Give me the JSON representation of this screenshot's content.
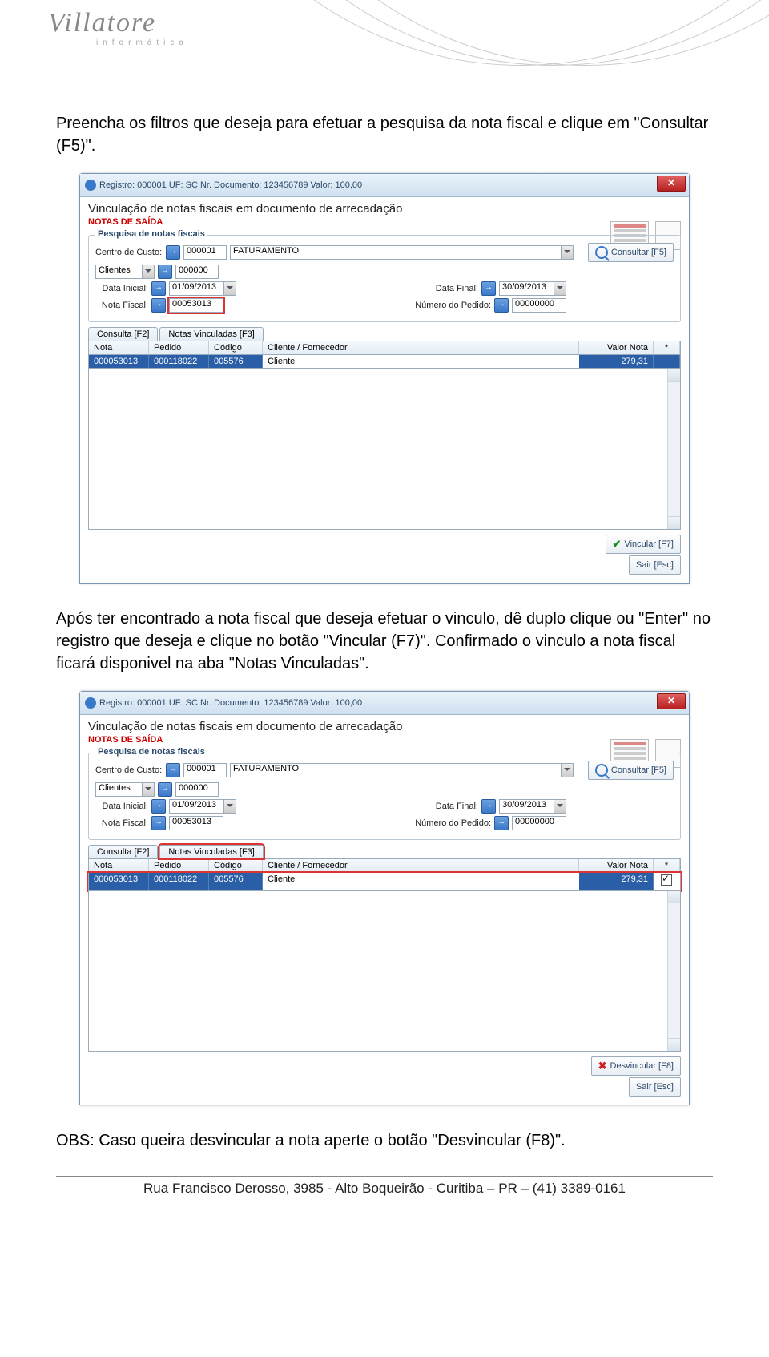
{
  "logo": {
    "brand": "Villatore",
    "sub": "informática"
  },
  "para1": "Preencha os filtros que deseja para efetuar a pesquisa da nota fiscal e clique em \"Consultar (F5)\".",
  "para2": "Após ter encontrado a nota fiscal que deseja efetuar o vinculo, dê duplo clique ou \"Enter\" no registro que deseja e clique no botão \"Vincular (F7)\". Confirmado o vinculo a nota fiscal ficará disponivel na aba \"Notas Vinculadas\".",
  "para3": "OBS: Caso queira desvincular a nota aperte o botão \"Desvincular (F8)\".",
  "footer": "Rua Francisco Derosso, 3985  - Alto Boqueirão - Curitiba – PR  – (41) 3389-0161",
  "win": {
    "title": "Registro: 000001 UF: SC Nr. Documento: 123456789 Valor: 100,00",
    "heading": "Vinculação de notas fiscais em documento de arrecadação",
    "sub": "NOTAS DE SAÍDA",
    "group": "Pesquisa de notas fiscais",
    "labels": {
      "centro": "Centro de Custo:",
      "clientes": "Clientes",
      "dataini": "Data Inicial:",
      "datafim": "Data Final:",
      "notafiscal": "Nota Fiscal:",
      "numpedido": "Número do Pedido:"
    },
    "values": {
      "cc_code": "000001",
      "cc_name": "FATURAMENTO",
      "cli_code": "000000",
      "dataini": "01/09/2013",
      "datafim": "30/09/2013",
      "nota": "00053013",
      "pedido": "00000000"
    },
    "tabs": {
      "consulta": "Consulta [F2]",
      "vinc": "Notas Vinculadas [F3]"
    },
    "columns": {
      "nota": "Nota",
      "pedido": "Pedido",
      "codigo": "Código",
      "cliente": "Cliente / Fornecedor",
      "valor": "Valor Nota",
      "ast": "*"
    },
    "row": {
      "nota": "000053013",
      "pedido": "000118022",
      "codigo": "005576",
      "cliente": "Cliente",
      "valor": "279,31"
    },
    "buttons": {
      "consultar": "Consultar [F5]",
      "vincular": "Vincular [F7]",
      "desvincular": "Desvincular [F8]",
      "sair": "Sair [Esc]"
    }
  }
}
